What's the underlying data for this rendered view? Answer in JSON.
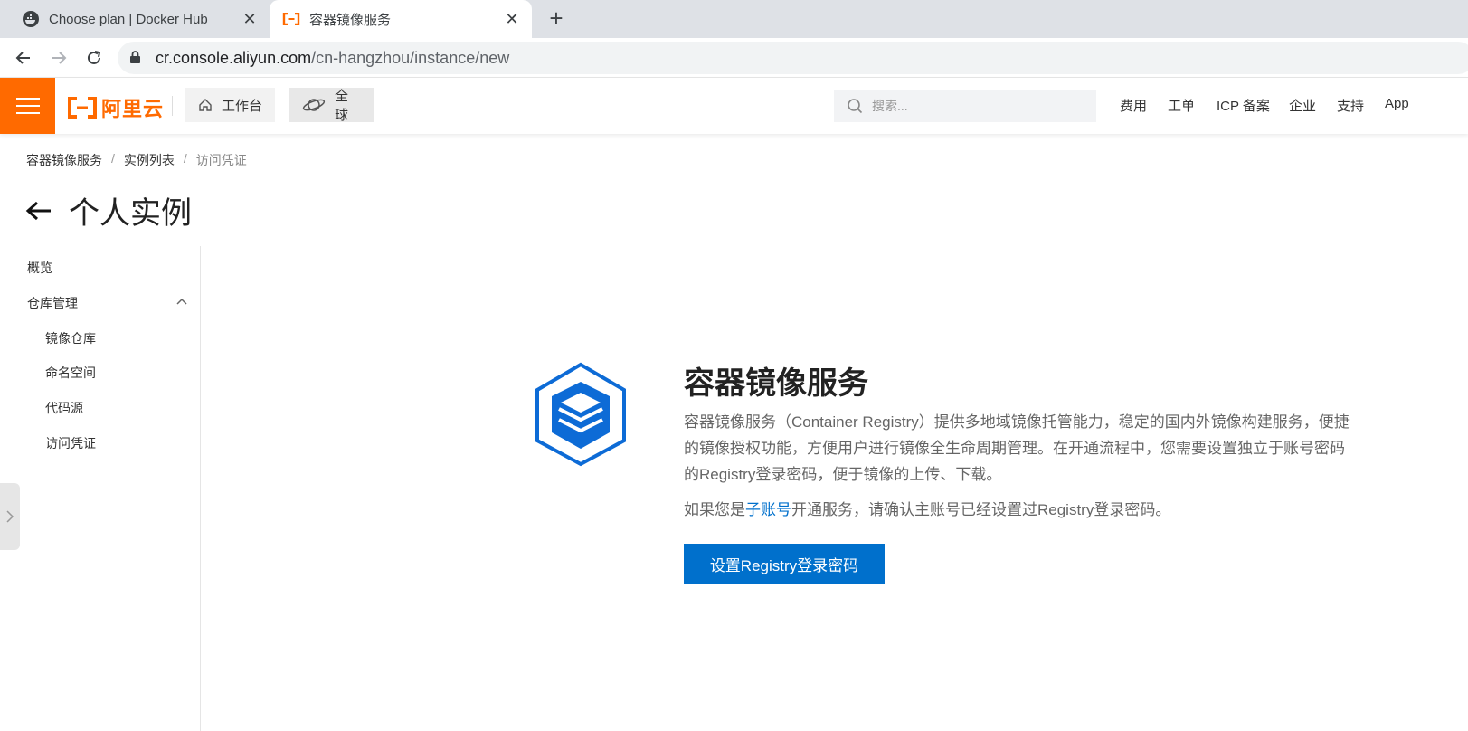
{
  "browser": {
    "tabs": [
      {
        "title": "Choose plan | Docker Hub",
        "favicon": "docker-whale-icon",
        "active": false
      },
      {
        "title": "容器镜像服务",
        "favicon": "aliyun-icon",
        "active": true
      }
    ],
    "url_host": "cr.console.aliyun.com",
    "url_path": "/cn-hangzhou/instance/new"
  },
  "topnav": {
    "logo_text": "阿里云",
    "workbench": "工作台",
    "region": "全球",
    "search_placeholder": "搜索...",
    "links": [
      "费用",
      "工单",
      "ICP 备案",
      "企业",
      "支持",
      "App"
    ]
  },
  "breadcrumb": {
    "items": [
      "容器镜像服务",
      "实例列表",
      "访问凭证"
    ],
    "separator": "/"
  },
  "page": {
    "title": "个人实例"
  },
  "sidenav": {
    "overview": "概览",
    "group": "仓库管理",
    "items": [
      "镜像仓库",
      "命名空间",
      "代码源",
      "访问凭证"
    ]
  },
  "main": {
    "title": "容器镜像服务",
    "description": "容器镜像服务（Container Registry）提供多地域镜像托管能力，稳定的国内外镜像构建服务，便捷的镜像授权功能，方便用户进行镜像全生命周期管理。在开通流程中，您需要设置独立于账号密码的Registry登录密码，便于镜像的上传、下载。",
    "note_before": "如果您是",
    "note_link": "子账号",
    "note_after": "开通服务，请确认主账号已经设置过Registry登录密码。",
    "button": "设置Registry登录密码"
  },
  "colors": {
    "brand_orange": "#ff6a00",
    "primary_blue": "#0070cc"
  }
}
